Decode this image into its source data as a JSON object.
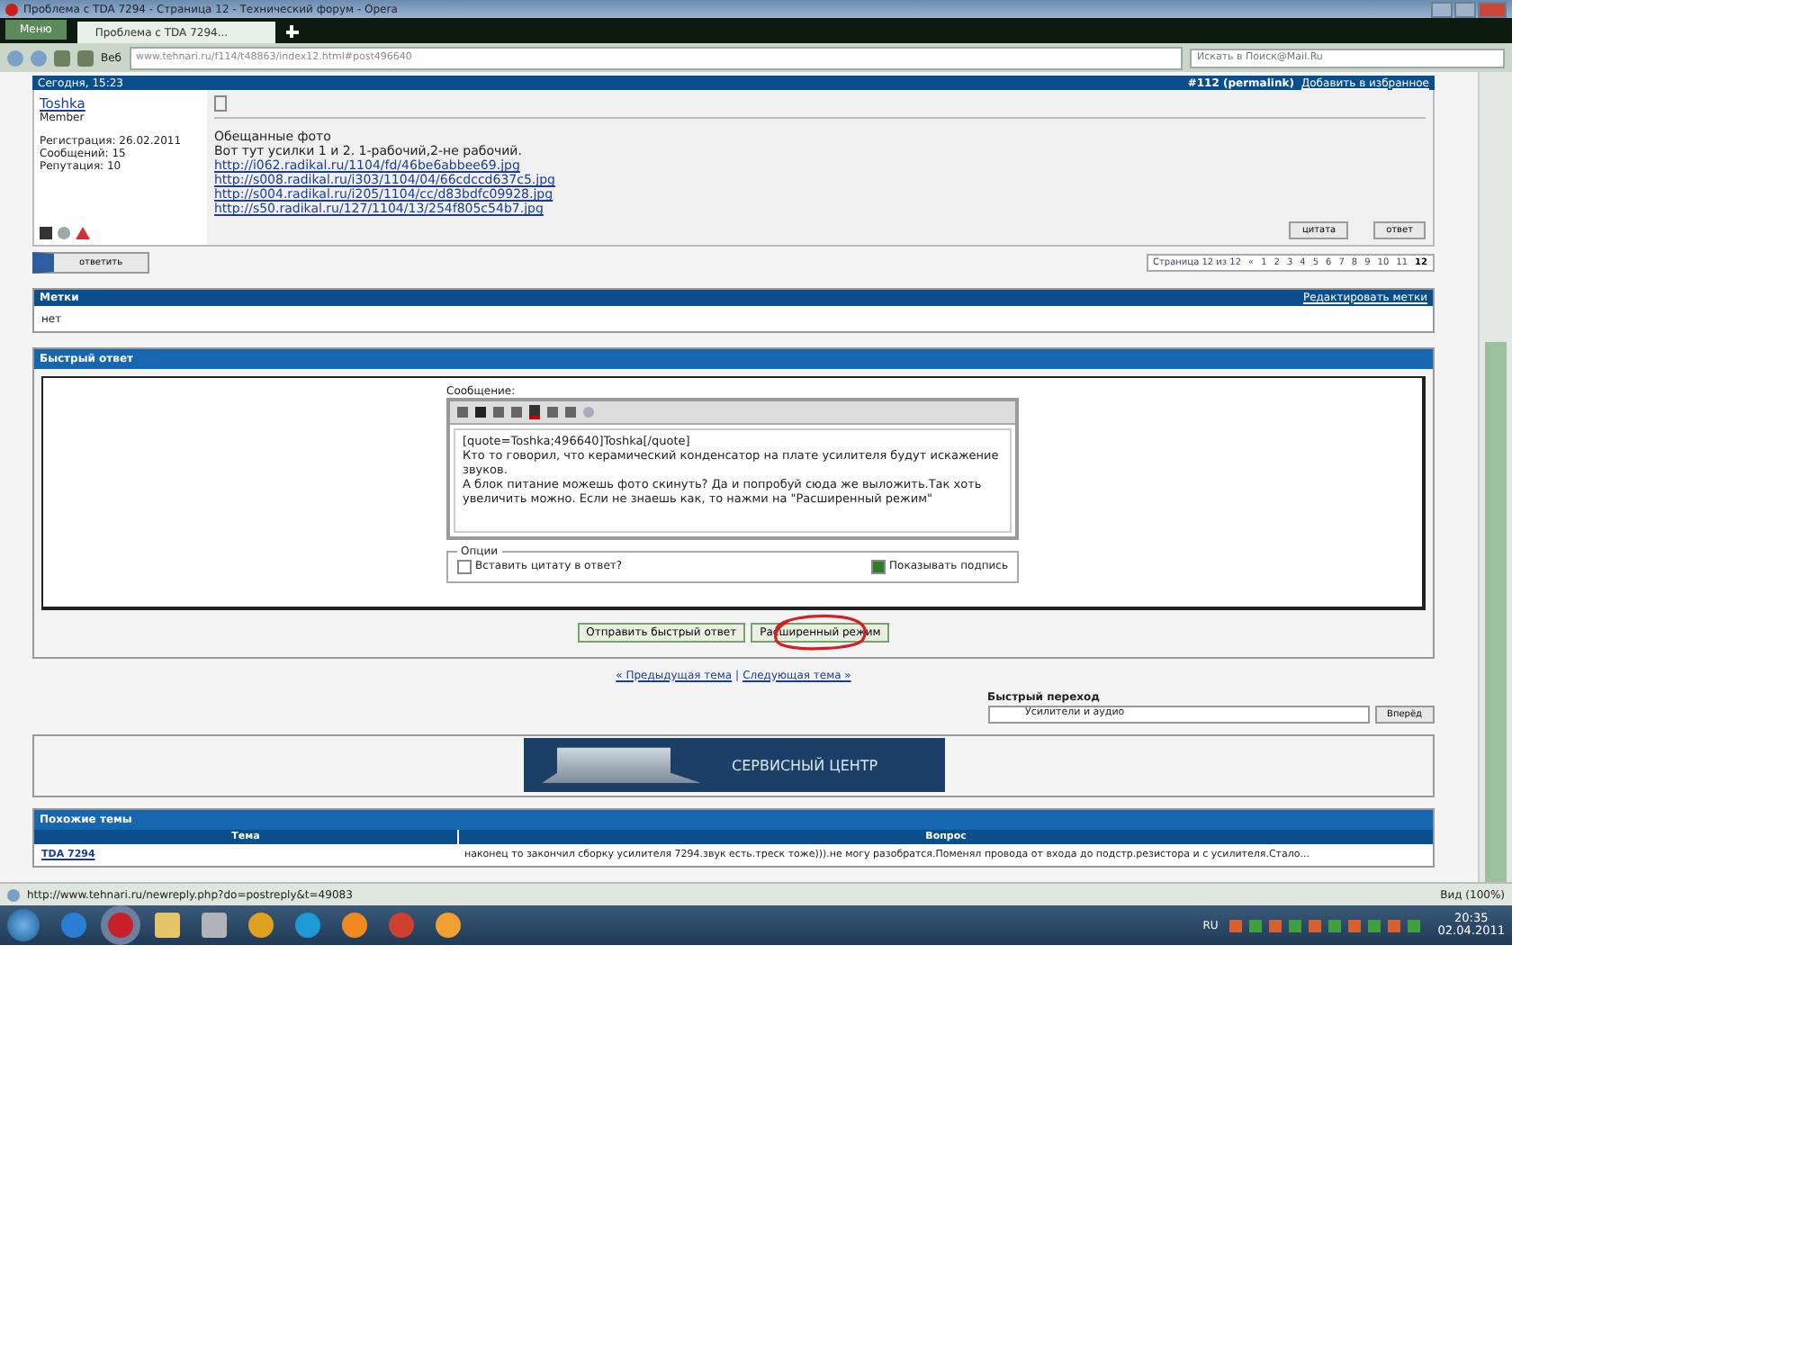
{
  "window": {
    "title": "Проблема с TDA 7294 - Страница 12 - Технический форум - Opera"
  },
  "menu_button": "Меню",
  "tabs": [
    {
      "label": "Проблема с TDA 7294...",
      "selected": true
    }
  ],
  "address_bar": {
    "web_label": "Веб",
    "url": "www.tehnari.ru/f114/t48863/index12.html#post496640",
    "search_placeholder": "Искать в Поиск@Mail.Ru"
  },
  "post": {
    "date": "Сегодня, 15:23",
    "number": "#112",
    "permalink": "(permalink)",
    "favorite_link": "Добавить в избранное",
    "author": "Toshka",
    "role": "Member",
    "stats": [
      "Регистрация: 26.02.2011",
      "Сообщений: 15",
      "Репутация: 10"
    ],
    "lines": [
      "Обещанные фото",
      "Вот тут усилки 1 и 2. 1-рабочий,2-не рабочий."
    ],
    "links": [
      "http://i062.radikal.ru/1104/fd/46be6abbee69.jpg",
      "http://s008.radikal.ru/i303/1104/04/66cdccd637c5.jpg",
      "http://s004.radikal.ru/i205/1104/cc/d83bdfc09928.jpg",
      "http://s50.radikal.ru/127/1104/13/254f805c54b7.jpg"
    ],
    "buttons": [
      "цитата",
      "ответ"
    ]
  },
  "reply_button": "ответить",
  "pagination": {
    "label": "Страница 12 из 12",
    "first": "«",
    "pages": [
      {
        "label": "1",
        "selected": false
      },
      {
        "label": "2",
        "selected": false
      },
      {
        "label": "3",
        "selected": false
      },
      {
        "label": "4",
        "selected": false
      },
      {
        "label": "5",
        "selected": false
      },
      {
        "label": "6",
        "selected": false
      },
      {
        "label": "7",
        "selected": false
      },
      {
        "label": "8",
        "selected": false
      },
      {
        "label": "9",
        "selected": false
      },
      {
        "label": "10",
        "selected": false
      },
      {
        "label": "11",
        "selected": false
      },
      {
        "label": "12",
        "selected": true
      }
    ]
  },
  "tags": {
    "title": "Метки",
    "value": "нет",
    "edit_link": "Редактировать метки"
  },
  "quick_reply": {
    "title": "Быстрый ответ",
    "message_label": "Сообщение:",
    "message": "[quote=Toshka;496640]Toshka[/quote]\nКто то говорил, что керамический конденсатор на плате усилителя будут искажение звуков.\nА блок питание можешь фото скинуть? Да и попробуй сюда же выложить.Так хоть увеличить можно. Если не знаешь как, то нажми на \"Расширенный режим\"",
    "options_label": "Опции",
    "options": [
      {
        "label": "Вставить цитату в ответ?",
        "checked": false
      },
      {
        "label": "Показывать подпись",
        "checked": true
      }
    ],
    "submit_button": "Отправить быстрый ответ",
    "advanced_button": "Расширенный режим"
  },
  "thread_nav": {
    "prev": "« Предыдущая тема",
    "separator": "|",
    "next": "Следующая тема »"
  },
  "quick_jump": {
    "label": "Быстрый переход",
    "value": "Усилители и аудио",
    "button": "Вперёд"
  },
  "banner": {
    "text": "СЕРВИСНЫЙ ЦЕНТР"
  },
  "similar": {
    "title": "Похожие темы",
    "columns": [
      "Тема",
      "Вопрос"
    ],
    "rows": [
      [
        "TDA 7294",
        "наконец то закончил сборку усилителя 7294.звук есть.треск тоже))).не могу разобратся.Поменял провода от входа до подстр.резистора и с усилителя.Стало..."
      ]
    ]
  },
  "status_bar": {
    "url": "http://www.tehnari.ru/newreply.php?do=postreply&t=49083",
    "zoom": "Вид (100%)"
  },
  "taskbar": {
    "language": "RU",
    "time": "20:35",
    "date": "02.04.2011"
  }
}
